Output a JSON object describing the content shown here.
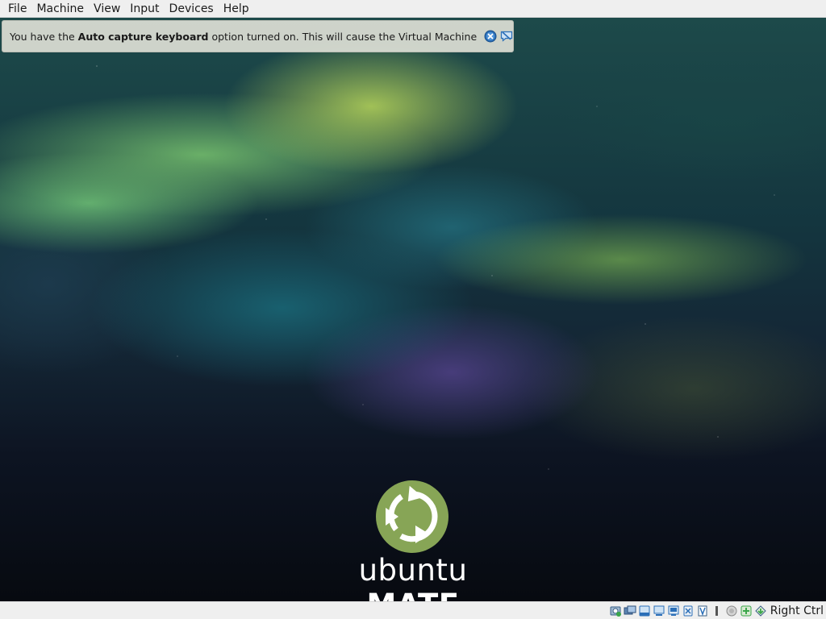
{
  "menubar": {
    "items": [
      {
        "label": "File"
      },
      {
        "label": "Machine"
      },
      {
        "label": "View"
      },
      {
        "label": "Input"
      },
      {
        "label": "Devices"
      },
      {
        "label": "Help"
      }
    ]
  },
  "notification": {
    "text_before": "You have the ",
    "text_bold": "Auto capture keyboard",
    "text_after": " option turned on. This will cause the Virtual Machine to",
    "close_icon": "close-icon",
    "dismiss_icon": "do-not-show-again-icon"
  },
  "desktop": {
    "logo_word_light": "ubuntu",
    "logo_word_bold": "MATE",
    "logo_color": "#87a556"
  },
  "statusbar": {
    "icons": [
      "hard-disk-icon",
      "optical-drive-icon",
      "audio-icon",
      "network-icon",
      "usb-icon",
      "shared-folders-icon",
      "display-icon",
      "recording-icon",
      "cpu-activity-icon",
      "mouse-integration-icon",
      "keyboard-capture-icon"
    ],
    "host_key": "Right Ctrl"
  }
}
